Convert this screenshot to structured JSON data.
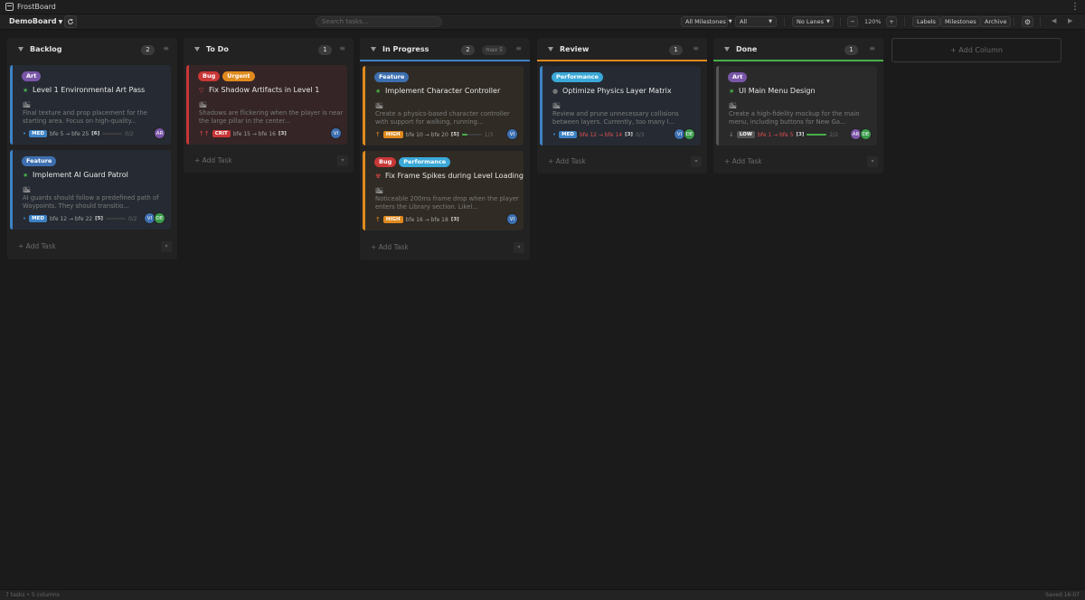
{
  "app": {
    "title": "FrostBoard"
  },
  "toolbar": {
    "board": "DemoBoard",
    "search_placeholder": "Search tasks...",
    "milestones": "All Milestones",
    "filter": "All",
    "lanes": "No Lanes",
    "zoom_minus": "−",
    "zoom": "120%",
    "zoom_plus": "+",
    "labels": "Labels",
    "milestones_btn": "Milestones",
    "archive": "Archive"
  },
  "columns": [
    {
      "title": "Backlog",
      "count": "2",
      "accent": "",
      "add_task": "+ Add Task",
      "cards": [
        {
          "tags": [
            {
              "label": "Art",
              "color": "#7a56a8"
            }
          ],
          "priority_icon": "★",
          "priority_color": "#46b04a",
          "title": "Level 1 Environmental Art Pass",
          "icon": "🏙",
          "desc": "Final texture and prop placement for the starting area. Focus on high-quality...",
          "arrow": "•",
          "arrow_color": "#3d82c4",
          "badge": "MED",
          "badge_color": "#3d82c4",
          "deadline": "bfe 5 → bfe 25",
          "late": false,
          "count": "[6]",
          "progress": 0,
          "ratio": "0/2",
          "avatars": [
            {
              "initials": "AR",
              "color": "#7a56a8"
            }
          ],
          "border": "#3d82c4",
          "bg": "#262b33"
        },
        {
          "tags": [
            {
              "label": "Feature",
              "color": "#3d6fb0"
            }
          ],
          "priority_icon": "★",
          "priority_color": "#46b04a",
          "title": "Implement AI Guard Patrol",
          "icon": "🏙",
          "desc": "AI guards should follow a predefined path of Waypoints. They should transitio...",
          "arrow": "•",
          "arrow_color": "#3d82c4",
          "badge": "MED",
          "badge_color": "#3d82c4",
          "deadline": "bfe 12 → bfe 22",
          "late": false,
          "count": "[5]",
          "progress": 0,
          "ratio": "0/2",
          "avatars": [
            {
              "initials": "VI",
              "color": "#3d6fb0"
            },
            {
              "initials": "DE",
              "color": "#3a9a4a"
            }
          ],
          "border": "#3d82c4",
          "bg": "#262b33"
        }
      ]
    },
    {
      "title": "To Do",
      "count": "1",
      "accent": "",
      "add_task": "+ Add Task",
      "cards": [
        {
          "tags": [
            {
              "label": "Bug",
              "color": "#c93737"
            },
            {
              "label": "Urgent",
              "color": "#e08a1e"
            }
          ],
          "priority_icon": "▽",
          "priority_color": "#e04545",
          "title": "Fix Shadow Artifacts in Level 1",
          "icon": "🏙",
          "desc": "Shadows are flickering when the player is near the large pillar in the center...",
          "arrow": "↑↑",
          "arrow_color": "#e04545",
          "badge": "CRIT",
          "badge_color": "#c93737",
          "deadline": "bfe 15 → bfe 16",
          "late": false,
          "count": "[3]",
          "progress": null,
          "ratio": "",
          "avatars": [
            {
              "initials": "VI",
              "color": "#3d6fb0"
            }
          ],
          "border": "#c93737",
          "bg": "#352526"
        }
      ]
    },
    {
      "title": "In Progress",
      "count": "2",
      "wip": "max 5",
      "accent": "#3d82c4",
      "add_task": "+ Add Task",
      "cards": [
        {
          "tags": [
            {
              "label": "Feature",
              "color": "#3d6fb0"
            }
          ],
          "priority_icon": "★",
          "priority_color": "#46b04a",
          "title": "Implement Character Controller",
          "icon": "🏙",
          "desc": "Create a physics-based character controller with support for walking, running...",
          "arrow": "↑",
          "arrow_color": "#e08a1e",
          "badge": "HIGH",
          "badge_color": "#e08a1e",
          "deadline": "bfe 10 → bfe 20",
          "late": false,
          "count": "[5]",
          "progress": 0.3,
          "ratio": "1/3",
          "avatars": [
            {
              "initials": "VI",
              "color": "#3d6fb0"
            }
          ],
          "border": "#e08a1e",
          "bg": "#302b24"
        },
        {
          "tags": [
            {
              "label": "Bug",
              "color": "#c93737"
            },
            {
              "label": "Performance",
              "color": "#3aa8d8"
            }
          ],
          "priority_icon": "☢",
          "priority_color": "#e04545",
          "title": "Fix Frame Spikes during Level Loading",
          "icon": "🏙",
          "desc": "Noticeable 200ms frame drop when the player enters the Library section. Likel...",
          "arrow": "↑",
          "arrow_color": "#e08a1e",
          "badge": "HIGH",
          "badge_color": "#e08a1e",
          "deadline": "bfe 16 → bfe 18",
          "late": false,
          "count": "[3]",
          "progress": null,
          "ratio": "",
          "avatars": [
            {
              "initials": "VI",
              "color": "#3d6fb0"
            }
          ],
          "border": "#e08a1e",
          "bg": "#302b24"
        }
      ]
    },
    {
      "title": "Review",
      "count": "1",
      "accent": "#e08a1e",
      "add_task": "+ Add Task",
      "cards": [
        {
          "tags": [
            {
              "label": "Performance",
              "color": "#3aa8d8"
            }
          ],
          "priority_icon": "●",
          "priority_color": "#777",
          "title": "Optimize Physics Layer Matrix",
          "icon": "🏙",
          "desc": "Review and prune unnecessary collisions between layers. Currently, too many l...",
          "arrow": "•",
          "arrow_color": "#3d82c4",
          "badge": "MED",
          "badge_color": "#3d82c4",
          "deadline": "bfe 12 → bfe 14",
          "late": true,
          "count": "[3]",
          "progress": null,
          "ratio": "0/3",
          "avatars": [
            {
              "initials": "VI",
              "color": "#3d6fb0"
            },
            {
              "initials": "DE",
              "color": "#3a9a4a"
            }
          ],
          "border": "#3d82c4",
          "bg": "#262b33"
        }
      ]
    },
    {
      "title": "Done",
      "count": "1",
      "accent": "#48b04a",
      "add_task": "+ Add Task",
      "cards": [
        {
          "tags": [
            {
              "label": "Art",
              "color": "#7a56a8"
            }
          ],
          "priority_icon": "★",
          "priority_color": "#46b04a",
          "title": "UI Main Menu Design",
          "icon": "🏙",
          "desc": "Create a high-fidelity mockup for the main menu, including buttons for New Ga...",
          "arrow": "↓",
          "arrow_color": "#888",
          "badge": "LOW",
          "badge_color": "#555",
          "deadline": "bfe 1 → bfe 5",
          "late": true,
          "count": "[3]",
          "progress": 1,
          "ratio": "2/2",
          "avatars": [
            {
              "initials": "AR",
              "color": "#7a56a8"
            },
            {
              "initials": "DE",
              "color": "#3a9a4a"
            }
          ],
          "border": "#555",
          "bg": "#2a2a2b"
        }
      ]
    }
  ],
  "add_column": "+ Add Column",
  "status": {
    "left": "7 tasks • 5 columns",
    "right": "Saved 16:07"
  }
}
